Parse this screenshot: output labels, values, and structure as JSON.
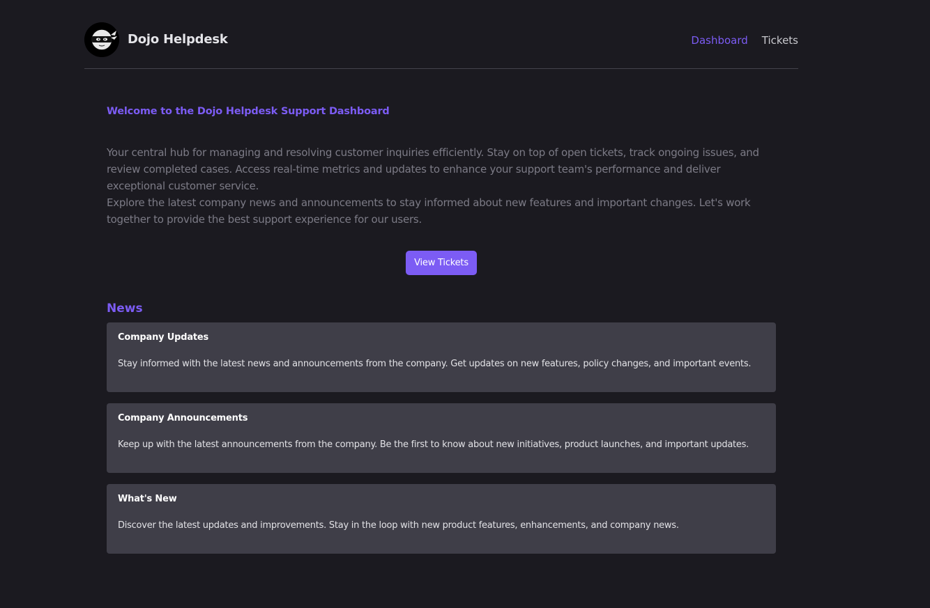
{
  "header": {
    "logo_icon": "ninja-icon",
    "brand": "Dojo Helpdesk",
    "nav": [
      {
        "label": "Dashboard",
        "active": true
      },
      {
        "label": "Tickets",
        "active": false
      }
    ]
  },
  "main": {
    "welcome_title": "Welcome to the Dojo Helpdesk Support Dashboard",
    "intro_paragraphs": [
      "Your central hub for managing and resolving customer inquiries efficiently. Stay on top of open tickets, track ongoing issues, and review completed cases. Access real-time metrics and updates to enhance your support team's performance and deliver exceptional customer service.",
      "Explore the latest company news and announcements to stay informed about new features and important changes. Let's work together to provide the best support experience for our users."
    ],
    "view_tickets_label": "View Tickets"
  },
  "news": {
    "title": "News",
    "items": [
      {
        "title": "Company Updates",
        "body": "Stay informed with the latest news and announcements from the company. Get updates on new features, policy changes, and important events."
      },
      {
        "title": "Company Announcements",
        "body": "Keep up with the latest announcements from the company. Be the first to know about new initiatives, product launches, and important updates."
      },
      {
        "title": "What's New",
        "body": "Discover the latest updates and improvements. Stay in the loop with new product features, enhancements, and company news."
      }
    ]
  },
  "colors": {
    "background": "#1b1a20",
    "accent": "#7c5cf4",
    "card": "#3f3e48",
    "muted_text": "#7c7b86"
  }
}
